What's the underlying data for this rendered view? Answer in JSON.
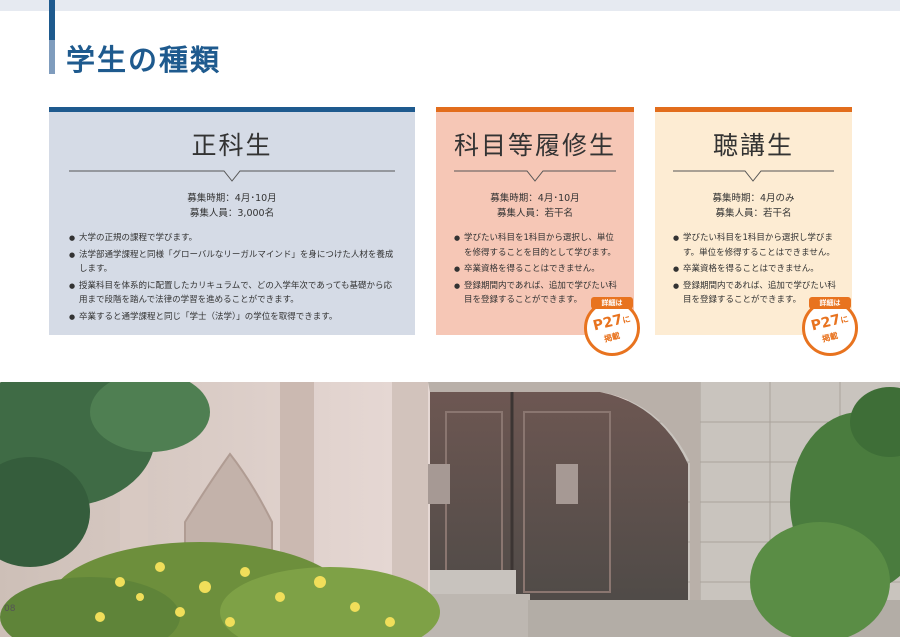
{
  "page": {
    "title": "学生の種類",
    "page_number": "08"
  },
  "colors": {
    "navy": "#1e5a8e",
    "orange": "#e26d1c",
    "card1_bg": "#d5dbe6",
    "card2_bg": "#f6c7b6",
    "card3_bg": "#fdecd3"
  },
  "cards": [
    {
      "title": "正科生",
      "recruit_period": "募集時期：4月･10月",
      "recruit_count": "募集人員：3,000名",
      "bullets": [
        "大学の正規の課程で学びます。",
        "法学部通学課程と同様「グローバルなリーガルマインド」を身につけた人材を養成します。",
        "授業科目を体系的に配置したカリキュラムで、どの入学年次であっても基礎から応用まで段階を踏んで法律の学習を進めることができます。",
        "卒業すると通学課程と同じ「学士（法学）」の学位を取得できます。"
      ]
    },
    {
      "title": "科目等履修生",
      "recruit_period": "募集時期：4月･10月",
      "recruit_count": "募集人員：若干名",
      "bullets": [
        "学びたい科目を1科目から選択し、単位を修得することを目的として学びます。",
        "卒業資格を得ることはできません。",
        "登録期間内であれば、追加で学びたい科目を登録することができます。"
      ],
      "badge": {
        "tag": "詳細は",
        "page": "P27",
        "suffix": "に",
        "label": "掲載"
      }
    },
    {
      "title": "聴講生",
      "recruit_period": "募集時期：4月のみ",
      "recruit_count": "募集人員：若干名",
      "bullets": [
        "学びたい科目を1科目から選択し学びます。単位を修得することはできません。",
        "卒業資格を得ることはできません。",
        "登録期間内であれば、追加で学びたい科目を登録することができます。"
      ],
      "badge": {
        "tag": "詳細は",
        "page": "P27",
        "suffix": "に",
        "label": "掲載"
      }
    }
  ],
  "photo": {
    "icon": "campus-gate-photo"
  }
}
